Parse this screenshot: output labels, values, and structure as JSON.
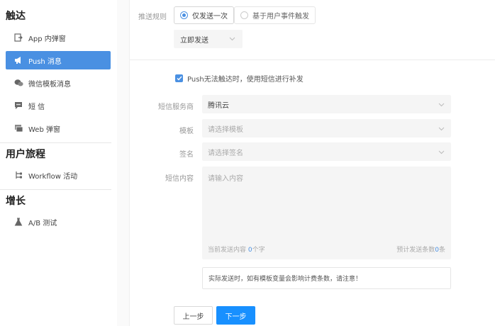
{
  "sidebar": {
    "sections": [
      {
        "title": "触达"
      },
      {
        "title": "用户旅程"
      },
      {
        "title": "增长"
      }
    ],
    "items": [
      {
        "label": "App 内弹窗",
        "icon": "app-popup-icon"
      },
      {
        "label": "Push 消息",
        "icon": "megaphone-icon"
      },
      {
        "label": "微信模板消息",
        "icon": "wechat-icon"
      },
      {
        "label": "短 信",
        "icon": "sms-icon"
      },
      {
        "label": "Web 弹窗",
        "icon": "web-popup-icon"
      },
      {
        "label": "Workflow 活动",
        "icon": "workflow-icon"
      },
      {
        "label": "A/B 测试",
        "icon": "flask-icon"
      }
    ],
    "active_index": 1
  },
  "push_rule": {
    "label": "推送规则",
    "options": [
      "仅发送一次",
      "基于用户事件触发"
    ],
    "selected_index": 0,
    "timing_value": "立即发送"
  },
  "sms_fallback": {
    "checkbox_label": "Push无法触达时，使用短信进行补发",
    "checked": true,
    "provider": {
      "label": "短信服务商",
      "value": "腾讯云"
    },
    "template": {
      "label": "模板",
      "placeholder": "请选择模板"
    },
    "signature": {
      "label": "签名",
      "placeholder": "请选择签名"
    },
    "content": {
      "label": "短信内容",
      "placeholder": "请输入内容",
      "count_prefix": "当前发送内容",
      "count_value": "0",
      "count_suffix": "个字",
      "est_prefix": "预计发送条数",
      "est_value": "0",
      "est_suffix": "条"
    },
    "notice": "实际发送时，如有模板变量会影响计费条数，请注意！"
  },
  "actions": {
    "prev_label": "上一步",
    "next_label": "下一步"
  },
  "colors": {
    "accent": "#4a90e2",
    "primary_button": "#1890ff"
  }
}
